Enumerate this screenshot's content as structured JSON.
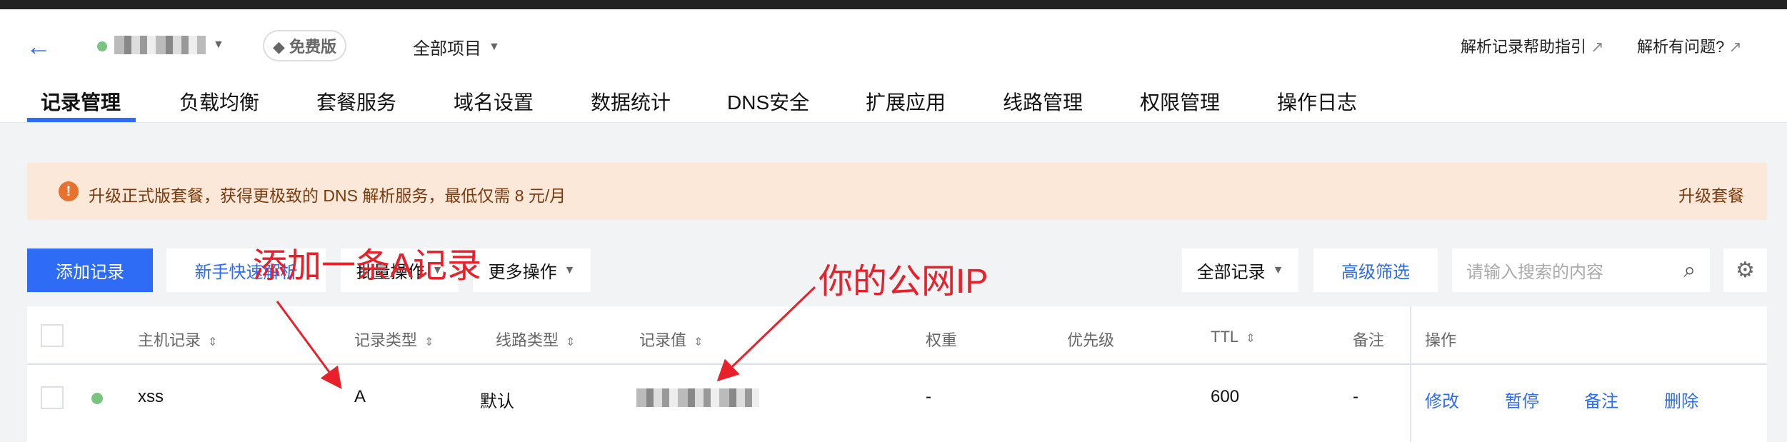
{
  "header": {
    "back_icon": "arrow-left-icon",
    "domain_status_color": "#7bc47f",
    "plan_badge": "免费版",
    "project_select": "全部项目",
    "help_link": "解析记录帮助指引",
    "issue_link": "解析有问题?"
  },
  "tabs": [
    {
      "label": "记录管理",
      "active": true
    },
    {
      "label": "负载均衡"
    },
    {
      "label": "套餐服务"
    },
    {
      "label": "域名设置"
    },
    {
      "label": "数据统计"
    },
    {
      "label": "DNS安全"
    },
    {
      "label": "扩展应用"
    },
    {
      "label": "线路管理"
    },
    {
      "label": "权限管理"
    },
    {
      "label": "操作日志"
    }
  ],
  "banner": {
    "text": "升级正式版套餐，获得更极致的 DNS 解析服务，最低仅需 8 元/月",
    "action": "升级套餐"
  },
  "toolbar": {
    "add": "添加记录",
    "quick": "新手快速解析",
    "batch": "批量操作",
    "more": "更多操作",
    "filter_select": "全部记录",
    "advanced": "高级筛选",
    "search_placeholder": "请输入搜索的内容"
  },
  "table": {
    "headers": [
      "主机记录",
      "记录类型",
      "线路类型",
      "记录值",
      "权重",
      "优先级",
      "TTL",
      "备注",
      "操作"
    ],
    "rows": [
      {
        "host": "xss",
        "type": "A",
        "line": "默认",
        "weight": "-",
        "ttl": "600",
        "remark": "-",
        "actions": [
          "修改",
          "暂停",
          "备注",
          "删除"
        ]
      }
    ]
  },
  "annotations": {
    "a_record": "添加一条A记录",
    "public_ip": "你的公网IP",
    "color": "#e8202a"
  },
  "colors": {
    "accent": "#2f6cf6"
  }
}
